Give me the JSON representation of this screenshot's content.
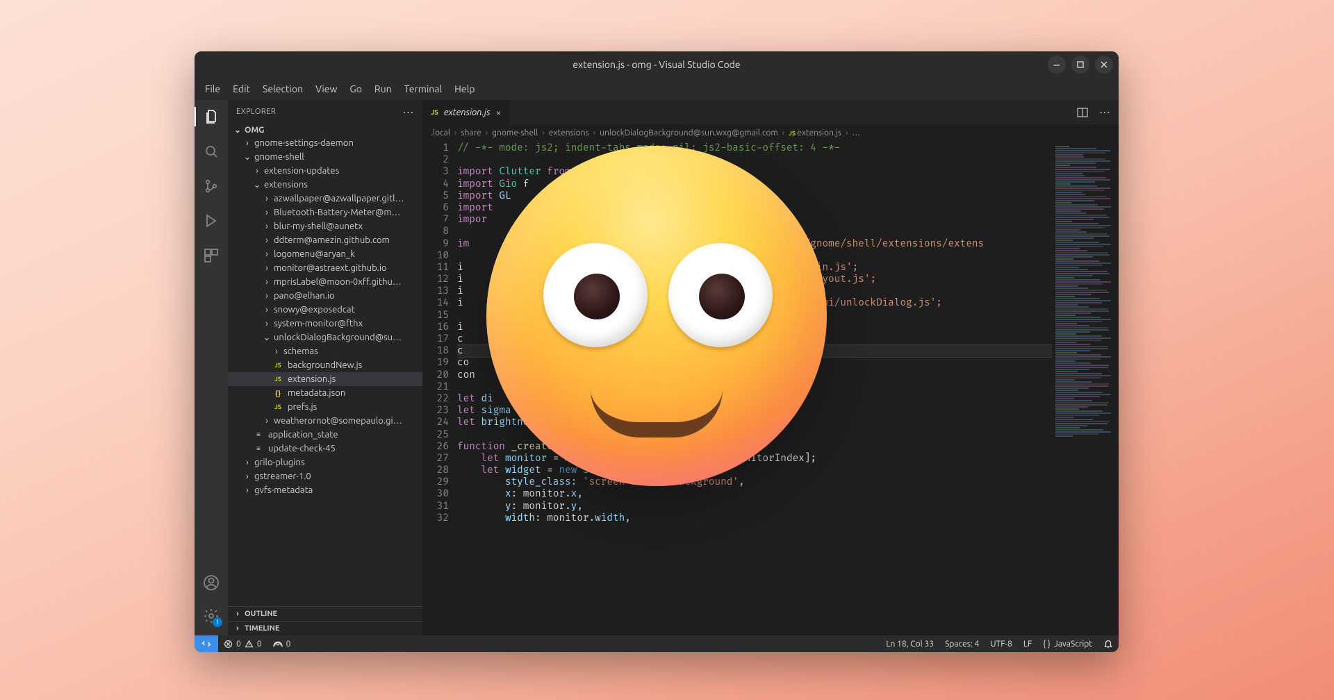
{
  "window": {
    "title": "extension.js - omg - Visual Studio Code"
  },
  "menubar": [
    "File",
    "Edit",
    "Selection",
    "View",
    "Go",
    "Run",
    "Terminal",
    "Help"
  ],
  "activitybar": {
    "settings_badge": "1"
  },
  "explorer": {
    "title": "EXPLORER",
    "root": "OMG",
    "tree": [
      {
        "d": 1,
        "arrow": ">",
        "t": "gnome-settings-daemon"
      },
      {
        "d": 1,
        "arrow": "v",
        "t": "gnome-shell"
      },
      {
        "d": 2,
        "arrow": ">",
        "t": "extension-updates"
      },
      {
        "d": 2,
        "arrow": "v",
        "t": "extensions"
      },
      {
        "d": 3,
        "arrow": ">",
        "t": "azwallpaper@azwallpaper.gitl…"
      },
      {
        "d": 3,
        "arrow": ">",
        "t": "Bluetooth-Battery-Meter@m…"
      },
      {
        "d": 3,
        "arrow": ">",
        "t": "blur-my-shell@aunetx"
      },
      {
        "d": 3,
        "arrow": ">",
        "t": "ddterm@amezin.github.com"
      },
      {
        "d": 3,
        "arrow": ">",
        "t": "logomenu@aryan_k"
      },
      {
        "d": 3,
        "arrow": ">",
        "t": "monitor@astraext.github.io"
      },
      {
        "d": 3,
        "arrow": ">",
        "t": "mprisLabel@moon-0xff.githu…"
      },
      {
        "d": 3,
        "arrow": ">",
        "t": "pano@elhan.io"
      },
      {
        "d": 3,
        "arrow": ">",
        "t": "snowy@exposedcat"
      },
      {
        "d": 3,
        "arrow": ">",
        "t": "system-monitor@fthx"
      },
      {
        "d": 3,
        "arrow": "v",
        "t": "unlockDialogBackground@su…"
      },
      {
        "d": 4,
        "arrow": ">",
        "t": "schemas"
      },
      {
        "d": 4,
        "ic": "js",
        "t": "backgroundNew.js"
      },
      {
        "d": 4,
        "ic": "js",
        "t": "extension.js",
        "sel": true
      },
      {
        "d": 4,
        "ic": "json",
        "t": "metadata.json"
      },
      {
        "d": 4,
        "ic": "js",
        "t": "prefs.js"
      },
      {
        "d": 3,
        "arrow": ">",
        "t": "weatherornot@somepaulo.gi…"
      },
      {
        "d": 2,
        "ic": "txt",
        "t": "application_state"
      },
      {
        "d": 2,
        "ic": "txt",
        "t": "update-check-45"
      },
      {
        "d": 1,
        "arrow": ">",
        "t": "grilo-plugins"
      },
      {
        "d": 1,
        "arrow": ">",
        "t": "gstreamer-1.0"
      },
      {
        "d": 1,
        "arrow": ">",
        "t": "gvfs-metadata"
      }
    ],
    "outline": "OUTLINE",
    "timeline": "TIMELINE"
  },
  "tab": {
    "name": "extension.js"
  },
  "breadcrumbs": [
    ".local",
    "share",
    "gnome-shell",
    "extensions",
    "unlockDialogBackground@sun.wxg@gmail.com",
    "extension.js",
    "…"
  ],
  "code": {
    "first_line": 1,
    "lines": [
      {
        "t": "// -*- mode: js2; indent-tabs-mode: nil; js2-basic-offset: 4 -*-",
        "cls": "c"
      },
      {
        "t": ""
      },
      {
        "t": "import Clutter from                        ",
        "kw": "import",
        "id": "Clutter"
      },
      {
        "t": "import Gio f",
        "kw": "import",
        "id": "Gio"
      },
      {
        "t": "import GL",
        "kw": "import",
        "id": "GL"
      },
      {
        "t": "import",
        "kw": "import"
      },
      {
        "t": "impor",
        "kw": "impor"
      },
      {
        "t": ""
      },
      {
        "t": "im                                                   //org/gnome/shell/extensions/extens",
        "kw": "im",
        "str": "//org/gnome/shell/extensions/extens"
      },
      {
        "t": ""
      },
      {
        "t": "i                                                     /ui/main.js';",
        "str": "/ui/main.js';"
      },
      {
        "t": "i                                                     l/ui/layout.js';",
        "str": "l/ui/layout.js';"
      },
      {
        "t": "i                                                      ;"
      },
      {
        "t": "i                                                     /shell/ui/unlockDialog.js';",
        "str": "/shell/ui/unlockDialog.js';"
      },
      {
        "t": ""
      },
      {
        "t": "i"
      },
      {
        "t": "c"
      },
      {
        "t": "c",
        "cur": true
      },
      {
        "t": "co"
      },
      {
        "t": "con"
      },
      {
        "t": ""
      },
      {
        "t": "let di",
        "kw": "let",
        "id": "di"
      },
      {
        "t": "let sigma",
        "kw": "let",
        "id": "sigma"
      },
      {
        "t": "let brightnes",
        "kw": "let",
        "id": "brightnes"
      },
      {
        "t": ""
      },
      {
        "t": "function _createBackgroundNew(monitorIndex) {",
        "kw": "function",
        "fn": "_createBackgroundNew",
        "id": "monitorIndex"
      },
      {
        "t": "    let monitor = Main.layoutManager.monitors[monitorIndex];",
        "kw": "let",
        "id": "monitor"
      },
      {
        "t": "    let widget = new St.Widget({",
        "kw": "let",
        "id": "widget",
        "new": "new",
        "cls2": "St.Widget"
      },
      {
        "t": "        style_class: 'screen-shield-background',",
        "id": "style_class",
        "str": "'screen-shield-background'"
      },
      {
        "t": "        x: monitor.x,",
        "id": "x"
      },
      {
        "t": "        y: monitor.y,",
        "id": "y"
      },
      {
        "t": "        width: monitor.width,",
        "id": "width"
      }
    ]
  },
  "status": {
    "errors": "0",
    "warnings": "0",
    "ports": "0",
    "lncol": "Ln 18, Col 33",
    "spaces": "Spaces: 4",
    "encoding": "UTF-8",
    "eol": "LF",
    "lang_ic": "{ }",
    "lang": "JavaScript"
  }
}
